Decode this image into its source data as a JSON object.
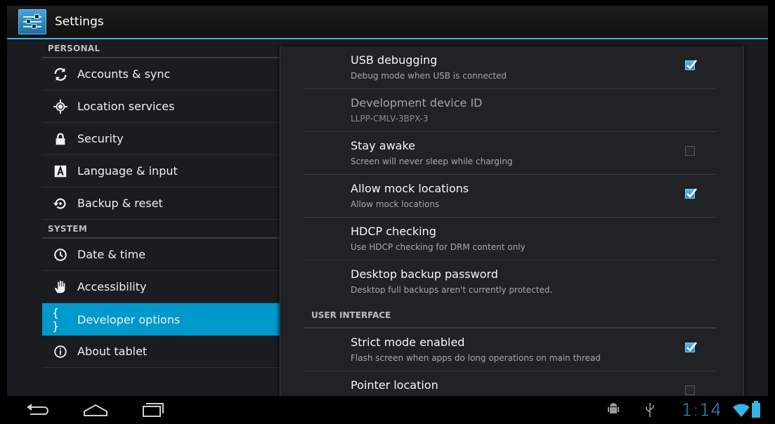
{
  "app": {
    "title": "Settings"
  },
  "sidebar": {
    "personal_header": "PERSONAL",
    "personal_items": [
      {
        "label": "Accounts & sync",
        "icon": "sync-icon"
      },
      {
        "label": "Location services",
        "icon": "location-icon"
      },
      {
        "label": "Security",
        "icon": "lock-icon"
      },
      {
        "label": "Language & input",
        "icon": "keyboard-icon"
      },
      {
        "label": "Backup & reset",
        "icon": "backup-icon"
      }
    ],
    "system_header": "SYSTEM",
    "system_items": [
      {
        "label": "Date & time",
        "icon": "clock-icon"
      },
      {
        "label": "Accessibility",
        "icon": "hand-icon"
      },
      {
        "label": "Developer options",
        "icon": "braces-icon",
        "icon_text": "{ }",
        "selected": true
      },
      {
        "label": "About tablet",
        "icon": "info-icon"
      }
    ]
  },
  "panel": {
    "prefs_top": [
      {
        "title": "USB debugging",
        "summary": "Debug mode when USB is connected",
        "checkbox": "checked"
      },
      {
        "title": "Development device ID",
        "summary": "LLPP-CMLV-3BPX-3",
        "disabled": true
      },
      {
        "title": "Stay awake",
        "summary": "Screen will never sleep while charging",
        "checkbox": "unchecked"
      },
      {
        "title": "Allow mock locations",
        "summary": "Allow mock locations",
        "checkbox": "checked"
      },
      {
        "title": "HDCP checking",
        "summary": "Use HDCP checking for DRM content only"
      },
      {
        "title": "Desktop backup password",
        "summary": "Desktop full backups aren't currently protected."
      }
    ],
    "ui_section_header": "USER INTERFACE",
    "prefs_ui": [
      {
        "title": "Strict mode enabled",
        "summary": "Flash screen when apps do long operations on main thread",
        "checkbox": "checked"
      },
      {
        "title": "Pointer location",
        "summary": "",
        "checkbox": "unchecked"
      }
    ]
  },
  "status": {
    "time": "1:14"
  },
  "colors": {
    "accent": "#33b5e5",
    "selected": "#0099cc"
  }
}
